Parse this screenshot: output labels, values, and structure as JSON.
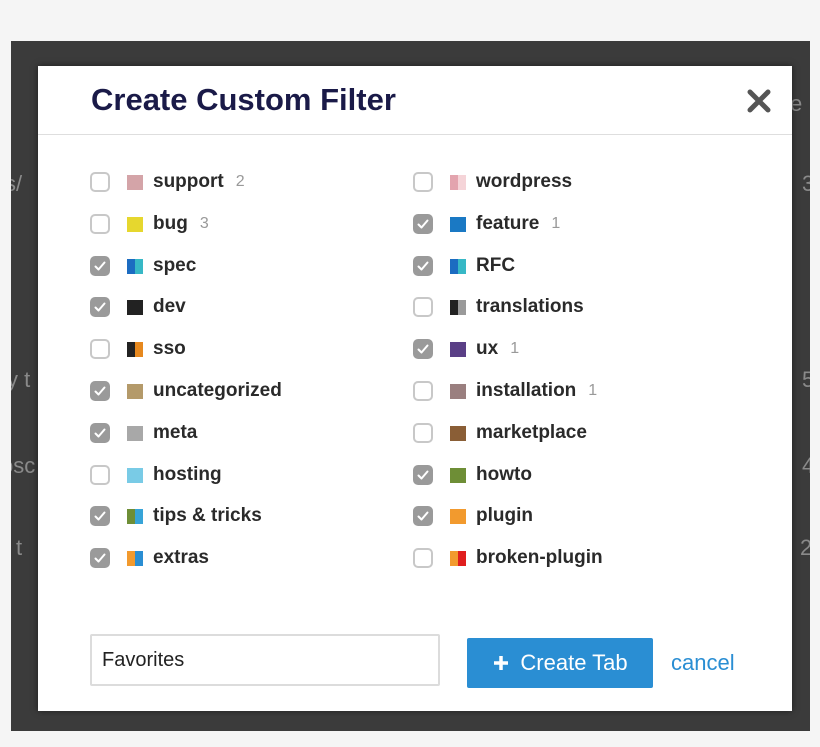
{
  "background": {
    "fragments": [
      "s/",
      "e",
      "3",
      "y t",
      "5",
      "osc",
      "4",
      "l t",
      "2"
    ]
  },
  "modal": {
    "title": "Create Custom Filter",
    "close_icon": "close-x-icon"
  },
  "labels_left": [
    {
      "name": "support",
      "count": "2",
      "checked": false,
      "colors": [
        "#d4a4a8"
      ]
    },
    {
      "name": "bug",
      "count": "3",
      "checked": false,
      "colors": [
        "#e6d72e"
      ]
    },
    {
      "name": "spec",
      "count": "",
      "checked": true,
      "colors": [
        "#1c6cc1",
        "#37b8c6"
      ]
    },
    {
      "name": "dev",
      "count": "",
      "checked": true,
      "colors": [
        "#222222"
      ]
    },
    {
      "name": "sso",
      "count": "",
      "checked": false,
      "colors": [
        "#222222",
        "#e6881e"
      ]
    },
    {
      "name": "uncategorized",
      "count": "",
      "checked": true,
      "colors": [
        "#b49a6a"
      ]
    },
    {
      "name": "meta",
      "count": "",
      "checked": true,
      "colors": [
        "#a8a8a8"
      ]
    },
    {
      "name": "hosting",
      "count": "",
      "checked": false,
      "colors": [
        "#79cbe6"
      ]
    },
    {
      "name": "tips & tricks",
      "count": "",
      "checked": true,
      "colors": [
        "#6e8e36",
        "#37a4d8"
      ]
    },
    {
      "name": "extras",
      "count": "",
      "checked": true,
      "colors": [
        "#f29a2e",
        "#2a8ed3"
      ]
    }
  ],
  "labels_right": [
    {
      "name": "wordpress",
      "count": "",
      "checked": false,
      "colors": [
        "#e3a4ae",
        "#f5d4d8"
      ]
    },
    {
      "name": "feature",
      "count": "1",
      "checked": true,
      "colors": [
        "#1a79c4"
      ]
    },
    {
      "name": "RFC",
      "count": "",
      "checked": true,
      "colors": [
        "#1c6cc1",
        "#37b8c6"
      ]
    },
    {
      "name": "translations",
      "count": "",
      "checked": false,
      "colors": [
        "#222222",
        "#9a9a9a"
      ]
    },
    {
      "name": "ux",
      "count": "1",
      "checked": true,
      "colors": [
        "#5a3f86"
      ]
    },
    {
      "name": "installation",
      "count": "1",
      "checked": false,
      "colors": [
        "#9a7f7f"
      ]
    },
    {
      "name": "marketplace",
      "count": "",
      "checked": false,
      "colors": [
        "#8a5e36"
      ]
    },
    {
      "name": "howto",
      "count": "",
      "checked": true,
      "colors": [
        "#6e8e36"
      ]
    },
    {
      "name": "plugin",
      "count": "",
      "checked": true,
      "colors": [
        "#f29a2e"
      ]
    },
    {
      "name": "broken-plugin",
      "count": "",
      "checked": false,
      "colors": [
        "#f29a2e",
        "#e01e1e"
      ]
    }
  ],
  "footer": {
    "tab_name_value": "Favorites",
    "create_label": "Create Tab",
    "cancel_label": "cancel"
  },
  "colors": {
    "accent": "#2a8ed3",
    "title": "#1a1a48",
    "checked_box": "#9a9a9a"
  }
}
